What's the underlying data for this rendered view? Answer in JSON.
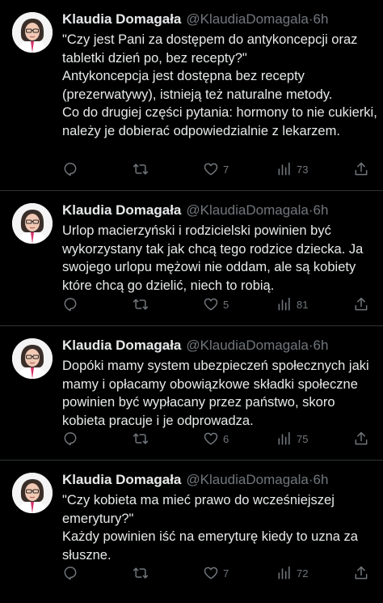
{
  "tweets": [
    {
      "author": {
        "name": "Klaudia Domagała",
        "handle": "@KlaudiaDomagala",
        "separator": "·",
        "time": "6h"
      },
      "paragraphs": [
        "\"Czy jest Pani za dostępem do antykoncepcji oraz tabletki dzień po, bez recepty?\"",
        "Antykoncepcja jest dostępna bez recepty (prezerwatywy), istnieją też naturalne metody.",
        "Co do drugiej części pytania: hormony to nie cukierki, należy je dobierać odpowiedzialnie z lekarzem."
      ],
      "stats": {
        "replies": "",
        "retweets": "",
        "likes": "7",
        "views": "73"
      }
    },
    {
      "author": {
        "name": "Klaudia Domagała",
        "handle": "@KlaudiaDomagala",
        "separator": "·",
        "time": "6h"
      },
      "paragraphs": [
        "Urlop macierzyński i rodzicielski powinien być wykorzystany tak jak chcą tego rodzice dziecka. Ja swojego urlopu mężowi nie oddam, ale są kobiety które chcą go dzielić, niech to robią."
      ],
      "stats": {
        "replies": "",
        "retweets": "",
        "likes": "5",
        "views": "81"
      }
    },
    {
      "author": {
        "name": "Klaudia Domagała",
        "handle": "@KlaudiaDomagala",
        "separator": "·",
        "time": "6h"
      },
      "paragraphs": [
        "Dopóki mamy system ubezpieczeń społecznych jaki mamy i opłacamy obowiązkowe składki społeczne powinien być wypłacany przez państwo, skoro kobieta pracuje i je odprowadza."
      ],
      "stats": {
        "replies": "",
        "retweets": "",
        "likes": "6",
        "views": "75"
      }
    },
    {
      "author": {
        "name": "Klaudia Domagała",
        "handle": "@KlaudiaDomagala",
        "separator": "·",
        "time": "6h"
      },
      "paragraphs": [
        "\"Czy kobieta ma mieć prawo do wcześniejszej emerytury?\"",
        "Każdy powinien iść na emeryturę kiedy to uzna za słuszne."
      ],
      "stats": {
        "replies": "",
        "retweets": "",
        "likes": "7",
        "views": "72"
      }
    }
  ],
  "icons": {
    "reply": "reply-icon",
    "retweet": "retweet-icon",
    "like": "heart-icon",
    "views": "views-chart-icon",
    "share": "share-icon"
  },
  "colors": {
    "background": "#000000",
    "text": "#e7e9ea",
    "secondary": "#71767b",
    "divider": "#2f3336"
  }
}
